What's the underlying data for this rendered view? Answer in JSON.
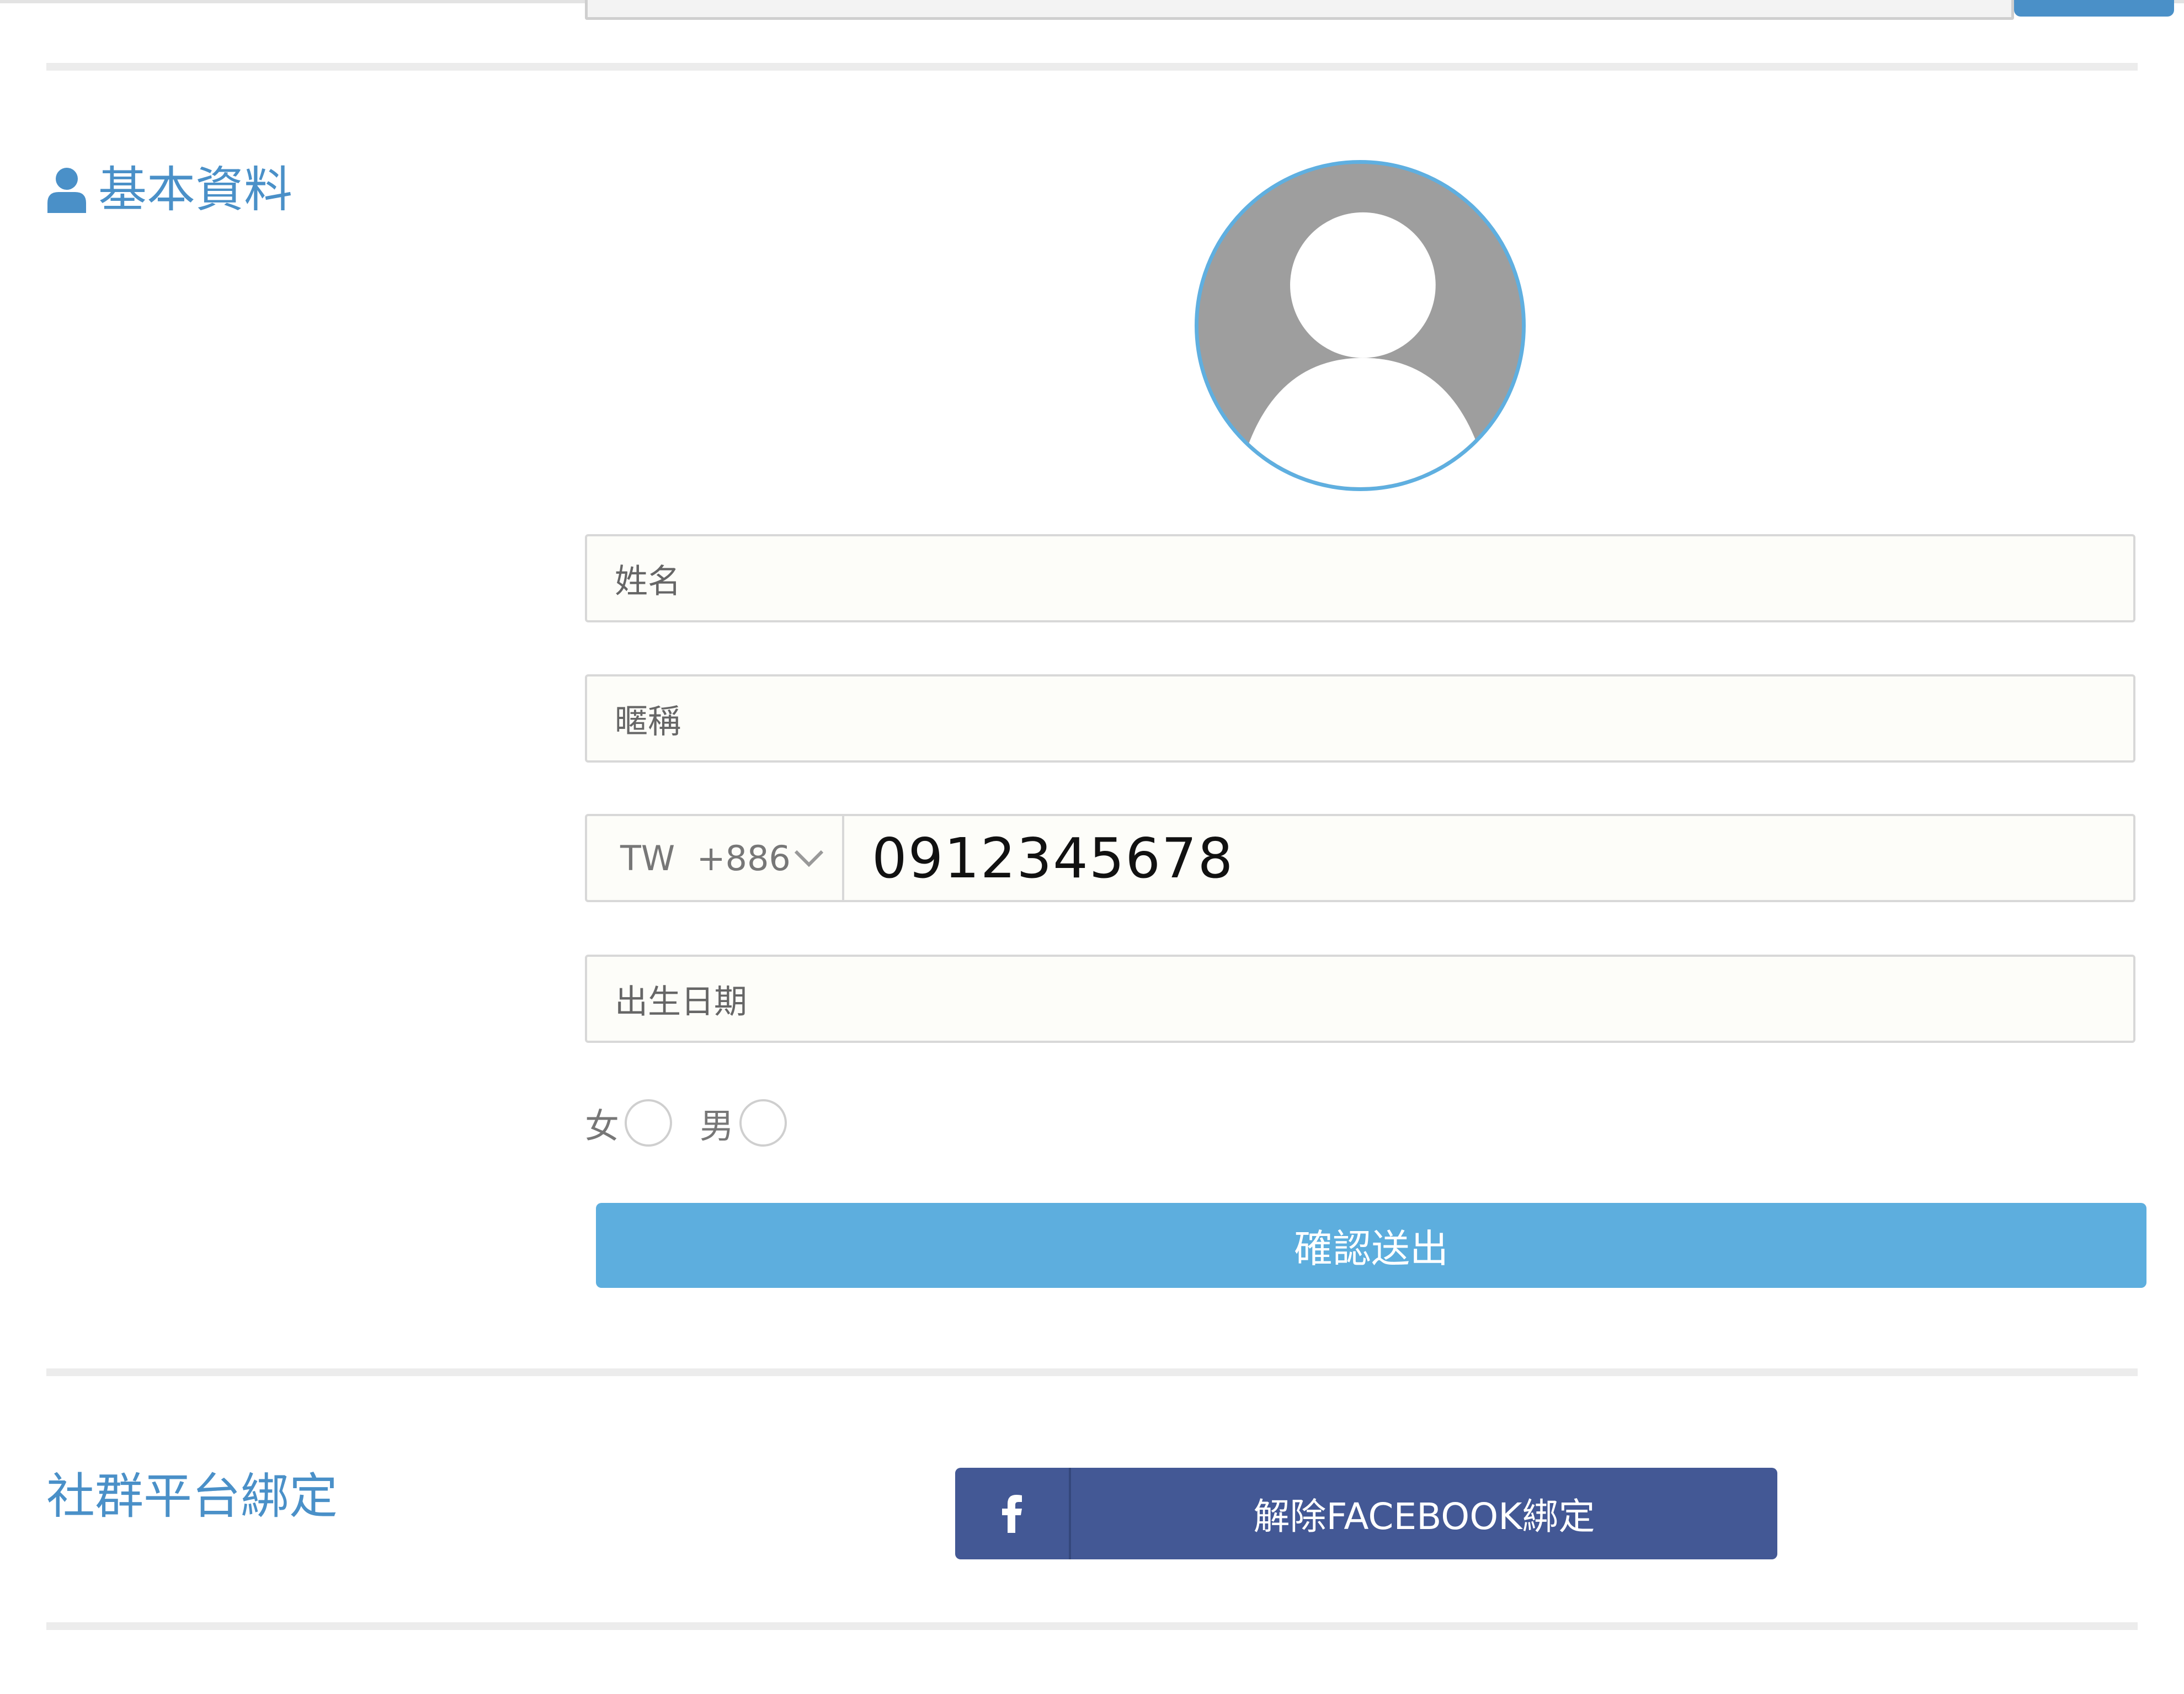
{
  "basic_info": {
    "title": "基本資料",
    "icon": "user-icon"
  },
  "form": {
    "name_placeholder": "姓名",
    "nickname_placeholder": "暱稱",
    "country_code": "TW  +886",
    "phone_value": "0912345678",
    "birthday_placeholder": "出生日期",
    "gender_female": "女",
    "gender_male": "男",
    "submit_label": "確認送出"
  },
  "social": {
    "title": "社群平台綁定",
    "facebook_button": "解除FACEBOOK綁定",
    "facebook_icon": "facebook-icon"
  },
  "colors": {
    "accent": "#4a90c8",
    "submit": "#5daede",
    "facebook": "#435895"
  }
}
